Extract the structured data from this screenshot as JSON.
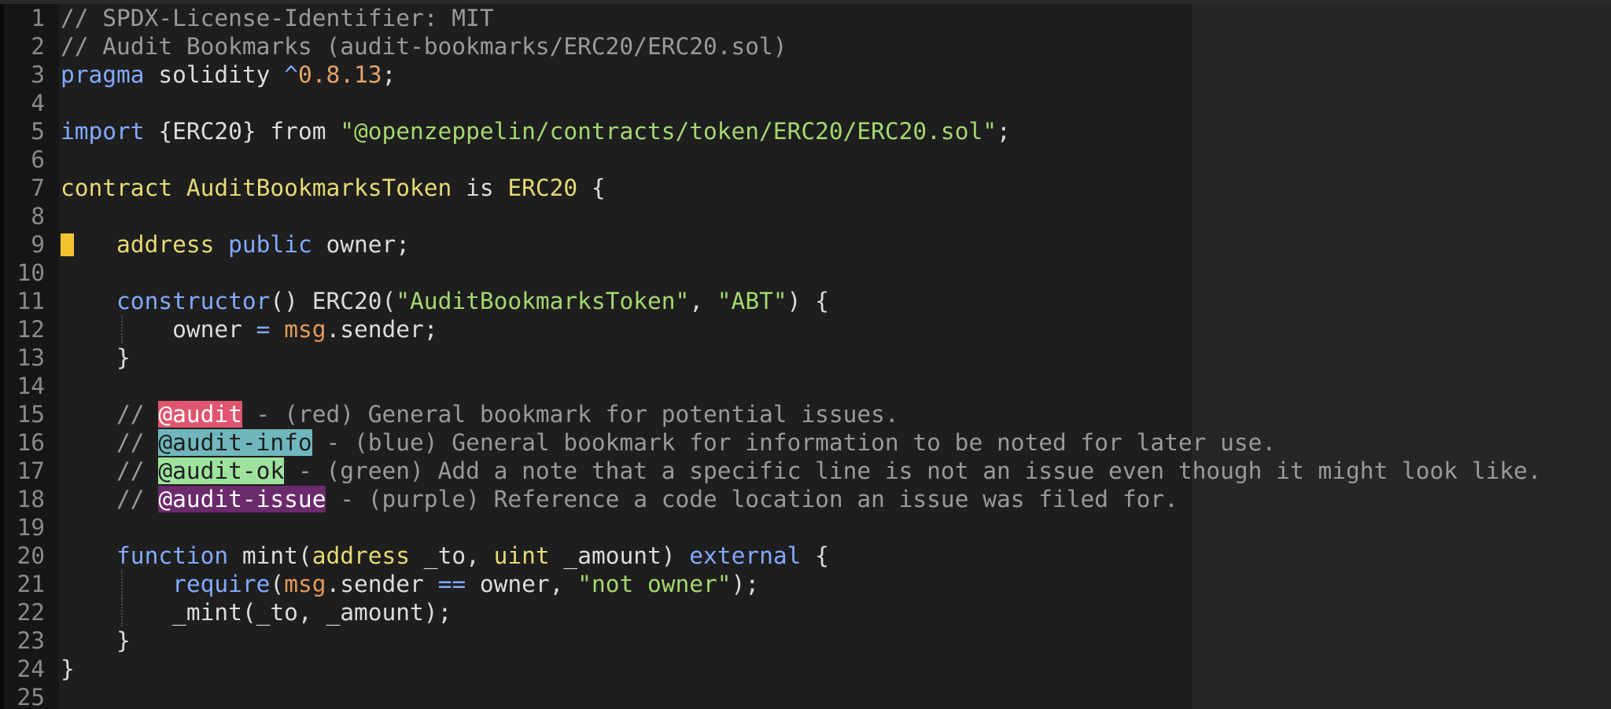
{
  "colors": {
    "background": "#1e1e1e",
    "gutter": "#161616",
    "right_pane": "#262626",
    "marker": "#f4c430",
    "audit_red": "#e0566e",
    "audit_blue": "#6fb7bd",
    "audit_green": "#9ee29e",
    "audit_purple": "#6b2a6b"
  },
  "gutter_marker": {
    "line": 9,
    "color": "#f4c430"
  },
  "lines": [
    {
      "num": "1",
      "tokens": [
        {
          "t": "// SPDX-License-Identifier: MIT",
          "c": "c"
        }
      ]
    },
    {
      "num": "2",
      "tokens": [
        {
          "t": "// Audit Bookmarks (audit-bookmarks/ERC20/ERC20.sol)",
          "c": "c"
        }
      ]
    },
    {
      "num": "3",
      "tokens": [
        {
          "t": "pragma",
          "c": "kw"
        },
        {
          "t": " solidity ",
          "c": "pl"
        },
        {
          "t": "^",
          "c": "kw"
        },
        {
          "t": "0.8.13",
          "c": "nu"
        },
        {
          "t": ";",
          "c": "pl"
        }
      ]
    },
    {
      "num": "4",
      "tokens": []
    },
    {
      "num": "5",
      "tokens": [
        {
          "t": "import",
          "c": "kw"
        },
        {
          "t": " {ERC20} from ",
          "c": "pl"
        },
        {
          "t": "\"@openzeppelin/contracts/token/ERC20/ERC20.sol\"",
          "c": "st"
        },
        {
          "t": ";",
          "c": "pl"
        }
      ]
    },
    {
      "num": "6",
      "tokens": []
    },
    {
      "num": "7",
      "tokens": [
        {
          "t": "contract",
          "c": "ty"
        },
        {
          "t": " ",
          "c": "pl"
        },
        {
          "t": "AuditBookmarksToken",
          "c": "ty"
        },
        {
          "t": " is ",
          "c": "pl"
        },
        {
          "t": "ERC20",
          "c": "ty"
        },
        {
          "t": " {",
          "c": "pl"
        }
      ]
    },
    {
      "num": "8",
      "tokens": []
    },
    {
      "num": "9",
      "marker": true,
      "tokens": [
        {
          "t": "    ",
          "c": "pl"
        },
        {
          "t": "address",
          "c": "ty"
        },
        {
          "t": " ",
          "c": "pl"
        },
        {
          "t": "public",
          "c": "kw"
        },
        {
          "t": " owner;",
          "c": "pl"
        }
      ]
    },
    {
      "num": "10",
      "tokens": []
    },
    {
      "num": "11",
      "tokens": [
        {
          "t": "    ",
          "c": "pl"
        },
        {
          "t": "constructor",
          "c": "kw"
        },
        {
          "t": "() ERC20(",
          "c": "pl"
        },
        {
          "t": "\"AuditBookmarksToken\"",
          "c": "st"
        },
        {
          "t": ", ",
          "c": "pl"
        },
        {
          "t": "\"ABT\"",
          "c": "st"
        },
        {
          "t": ") {",
          "c": "pl"
        }
      ]
    },
    {
      "num": "12",
      "guide": true,
      "tokens": [
        {
          "t": "        owner ",
          "c": "pl"
        },
        {
          "t": "=",
          "c": "kw"
        },
        {
          "t": " ",
          "c": "pl"
        },
        {
          "t": "msg",
          "c": "vr"
        },
        {
          "t": ".sender;",
          "c": "pl"
        }
      ]
    },
    {
      "num": "13",
      "tokens": [
        {
          "t": "    }",
          "c": "pl"
        }
      ]
    },
    {
      "num": "14",
      "tokens": []
    },
    {
      "num": "15",
      "tokens": [
        {
          "t": "    // ",
          "c": "c"
        },
        {
          "t": "@audit",
          "c": "tag-red"
        },
        {
          "t": " - (red) General bookmark for potential issues.",
          "c": "c"
        }
      ]
    },
    {
      "num": "16",
      "tokens": [
        {
          "t": "    // ",
          "c": "c"
        },
        {
          "t": "@audit-info",
          "c": "tag-blue"
        },
        {
          "t": " - (blue) General bookmark for information to be noted for later use.",
          "c": "c"
        }
      ]
    },
    {
      "num": "17",
      "tokens": [
        {
          "t": "    // ",
          "c": "c"
        },
        {
          "t": "@audit-ok",
          "c": "tag-green"
        },
        {
          "t": " - (green) Add a note that a specific line is not an issue even though it might look like.",
          "c": "c"
        }
      ]
    },
    {
      "num": "18",
      "tokens": [
        {
          "t": "    // ",
          "c": "c"
        },
        {
          "t": "@audit-issue",
          "c": "tag-purple"
        },
        {
          "t": " - (purple) Reference a code location an issue was filed for.",
          "c": "c"
        }
      ]
    },
    {
      "num": "19",
      "tokens": []
    },
    {
      "num": "20",
      "tokens": [
        {
          "t": "    ",
          "c": "pl"
        },
        {
          "t": "function",
          "c": "kw"
        },
        {
          "t": " mint(",
          "c": "pl"
        },
        {
          "t": "address",
          "c": "ty"
        },
        {
          "t": " _to, ",
          "c": "pl"
        },
        {
          "t": "uint",
          "c": "ty"
        },
        {
          "t": " _amount) ",
          "c": "pl"
        },
        {
          "t": "external",
          "c": "kw"
        },
        {
          "t": " {",
          "c": "pl"
        }
      ]
    },
    {
      "num": "21",
      "guide": true,
      "tokens": [
        {
          "t": "        ",
          "c": "pl"
        },
        {
          "t": "require",
          "c": "kw"
        },
        {
          "t": "(",
          "c": "pl"
        },
        {
          "t": "msg",
          "c": "vr"
        },
        {
          "t": ".sender ",
          "c": "pl"
        },
        {
          "t": "==",
          "c": "kw"
        },
        {
          "t": " owner, ",
          "c": "pl"
        },
        {
          "t": "\"not owner\"",
          "c": "st"
        },
        {
          "t": ");",
          "c": "pl"
        }
      ]
    },
    {
      "num": "22",
      "guide": true,
      "tokens": [
        {
          "t": "        _mint(_to, _amount);",
          "c": "pl"
        }
      ]
    },
    {
      "num": "23",
      "tokens": [
        {
          "t": "    }",
          "c": "pl"
        }
      ]
    },
    {
      "num": "24",
      "tokens": [
        {
          "t": "}",
          "c": "pl"
        }
      ]
    },
    {
      "num": "25",
      "tokens": []
    }
  ]
}
